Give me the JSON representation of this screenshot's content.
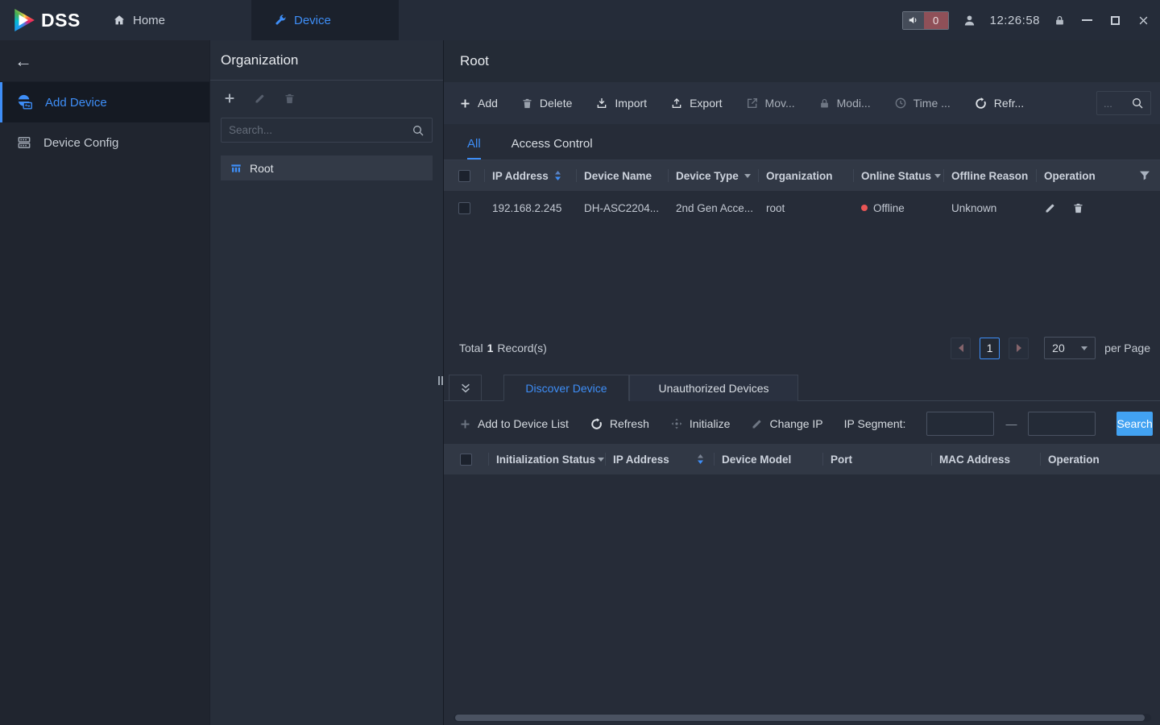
{
  "topbar": {
    "logo": "DSS",
    "home_tab": "Home",
    "device_tab": "Device",
    "alarm_count": "0",
    "clock": "12:26:58"
  },
  "sidebar": {
    "items": [
      {
        "label": "Add Device",
        "active": true
      },
      {
        "label": "Device Config",
        "active": false
      }
    ]
  },
  "organization": {
    "title": "Organization",
    "search_placeholder": "Search...",
    "root_node": "Root"
  },
  "main": {
    "title": "Root",
    "toolbar": {
      "add": "Add",
      "delete": "Delete",
      "import": "Import",
      "export": "Export",
      "move": "Mov...",
      "modify": "Modi...",
      "time": "Time ...",
      "refresh": "Refr...",
      "search_placeholder": "..."
    },
    "tabs": {
      "all": "All",
      "access_control": "Access Control"
    },
    "device_table": {
      "columns": [
        "IP Address",
        "Device Name",
        "Device Type",
        "Organization",
        "Online Status",
        "Offline Reason",
        "Operation"
      ],
      "rows": [
        {
          "ip": "192.168.2.245",
          "device_name": "DH-ASC2204...",
          "device_type": "2nd Gen Acce...",
          "organization": "root",
          "online_status": "Offline",
          "offline_reason": "Unknown"
        }
      ]
    },
    "pagination": {
      "total_label": "Total",
      "total_count": "1",
      "records_label": "Record(s)",
      "current_page": "1",
      "page_size": "20",
      "per_page_label": "per Page"
    }
  },
  "discover": {
    "tabs": {
      "discover": "Discover Device",
      "unauthorized": "Unauthorized Devices"
    },
    "toolbar": {
      "add_to_list": "Add to Device List",
      "refresh": "Refresh",
      "initialize": "Initialize",
      "change_ip": "Change IP",
      "ip_segment_label": "IP Segment:",
      "search_button": "Search"
    },
    "table": {
      "columns": [
        "Initialization Status",
        "IP Address",
        "Device Model",
        "Port",
        "MAC Address",
        "Operation"
      ]
    }
  },
  "colors": {
    "accent_blue": "#3E8EF7",
    "offline_red": "#E85555",
    "search_button_blue": "#42A2F2",
    "alarm_badge": "#8F5058"
  }
}
